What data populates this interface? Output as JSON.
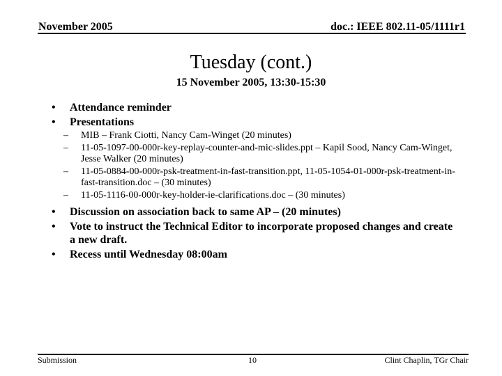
{
  "header": {
    "date": "November 2005",
    "doc_id": "doc.: IEEE 802.11-05/1111r1"
  },
  "title": "Tuesday (cont.)",
  "subtitle": "15 November 2005, 13:30-15:30",
  "bullets": [
    {
      "text": "Attendance reminder",
      "marker": "•"
    },
    {
      "text": "Presentations",
      "marker": "•",
      "sub": [
        {
          "marker": "–",
          "text": "MIB – Frank Ciotti, Nancy Cam-Winget (20 minutes)"
        },
        {
          "marker": "–",
          "text": "11-05-1097-00-000r-key-replay-counter-and-mic-slides.ppt – Kapil Sood, Nancy Cam-Winget, Jesse Walker (20 minutes)"
        },
        {
          "marker": "–",
          "text": "11-05-0884-00-000r-psk-treatment-in-fast-transition.ppt, 11-05-1054-01-000r-psk-treatment-in-fast-transition.doc – (30 minutes)"
        },
        {
          "marker": "–",
          "text": "11-05-1116-00-000r-key-holder-ie-clarifications.doc – (30 minutes)"
        }
      ]
    },
    {
      "text": "Discussion on association back to same AP – (20 minutes)",
      "marker": "•"
    },
    {
      "text": "Vote to instruct the Technical Editor to incorporate proposed changes and create a new draft.",
      "marker": "•"
    },
    {
      "text": "Recess until Wednesday 08:00am",
      "marker": "•"
    }
  ],
  "footer": {
    "left": "Submission",
    "page": "10",
    "right": "Clint Chaplin, TGr Chair"
  }
}
